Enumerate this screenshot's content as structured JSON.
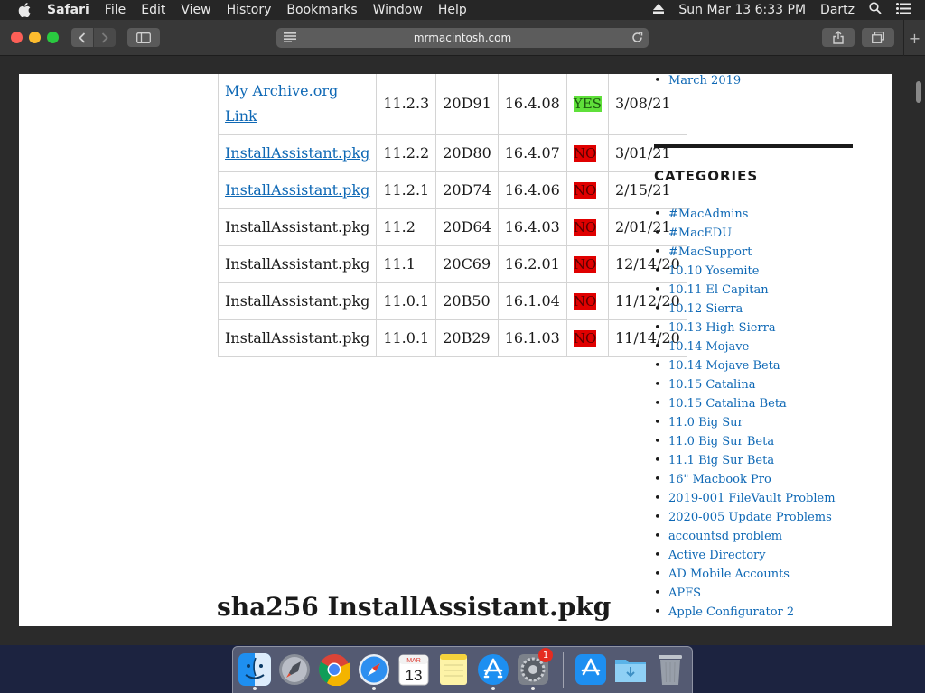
{
  "menubar": {
    "app_name": "Safari",
    "items": [
      "File",
      "Edit",
      "View",
      "History",
      "Bookmarks",
      "Window",
      "Help"
    ],
    "clock": "Sun Mar 13  6:33 PM",
    "user": "Dartz"
  },
  "browser": {
    "url": "mrmacintosh.com"
  },
  "table": {
    "rows": [
      {
        "link": "My Archive.org Link",
        "is_link": true,
        "version": "11.2.3",
        "build": "20D91",
        "size": "16.4.08",
        "status": "YES",
        "date": "3/08/21"
      },
      {
        "link": "InstallAssistant.pkg",
        "is_link": true,
        "version": "11.2.2",
        "build": "20D80",
        "size": "16.4.07",
        "status": "NO",
        "date": "3/01/21"
      },
      {
        "link": "InstallAssistant.pkg",
        "is_link": true,
        "version": "11.2.1",
        "build": "20D74",
        "size": "16.4.06",
        "status": "NO",
        "date": "2/15/21"
      },
      {
        "link": "InstallAssistant.pkg",
        "is_link": false,
        "version": "11.2",
        "build": "20D64",
        "size": "16.4.03",
        "status": "NO",
        "date": "2/01/21"
      },
      {
        "link": "InstallAssistant.pkg",
        "is_link": false,
        "version": "11.1",
        "build": "20C69",
        "size": "16.2.01",
        "status": "NO",
        "date": "12/14/20"
      },
      {
        "link": "InstallAssistant.pkg",
        "is_link": false,
        "version": "11.0.1",
        "build": "20B50",
        "size": "16.1.04",
        "status": "NO",
        "date": "11/12/20"
      },
      {
        "link": "InstallAssistant.pkg",
        "is_link": false,
        "version": "11.0.1",
        "build": "20B29",
        "size": "16.1.03",
        "status": "NO",
        "date": "11/14/20"
      }
    ]
  },
  "section_heading": "sha256 InstallAssistant.pkg",
  "sidebar": {
    "archive_item": "March 2019",
    "categories_heading": "CATEGORIES",
    "categories": [
      "#MacAdmins",
      "#MacEDU",
      "#MacSupport",
      "10.10 Yosemite",
      "10.11 El Capitan",
      "10.12 Sierra",
      "10.13 High Sierra",
      "10.14 Mojave",
      "10.14 Mojave Beta",
      "10.15 Catalina",
      "10.15 Catalina Beta",
      "11.0 Big Sur",
      "11.0 Big Sur Beta",
      "11.1 Big Sur Beta",
      "16\" Macbook Pro",
      "2019-001 FileVault Problem",
      "2020-005 Update Problems",
      "accountsd problem",
      "Active Directory",
      "AD Mobile Accounts",
      "APFS",
      "Apple Configurator 2"
    ]
  },
  "dock": {
    "calendar_month": "MAR",
    "calendar_day": "13",
    "badge_count": "1",
    "apps": [
      "finder-icon",
      "launchpad-icon",
      "chrome-icon",
      "safari-icon",
      "calendar-icon",
      "notes-icon",
      "app-store-icon",
      "system-preferences-icon",
      "app-store-download-icon",
      "downloads-folder-icon",
      "trash-icon"
    ]
  },
  "colors": {
    "link": "#0e68b5",
    "status_no": "#e00000",
    "status_yes": "#5fe03a"
  }
}
